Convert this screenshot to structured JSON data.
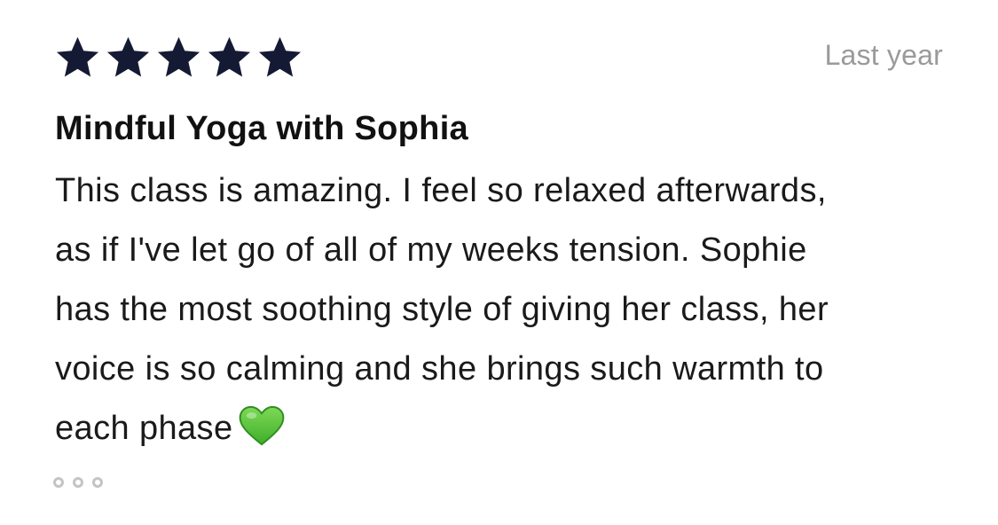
{
  "review": {
    "rating": 5,
    "rating_max": 5,
    "star_color": "#141a33",
    "date": "Last year",
    "title": "Mindful Yoga with Sophia",
    "body_lines": [
      "This class is amazing. I feel so relaxed afterwards,",
      "as if I've let go of all of my weeks tension. Sophie",
      "has the most soothing style of giving her class, her",
      "voice is so calming and she brings such warmth to",
      "each phase"
    ],
    "emoji": "green-heart"
  },
  "pagination": {
    "dot_count": 3,
    "dot_color": "#c4c4c4"
  }
}
